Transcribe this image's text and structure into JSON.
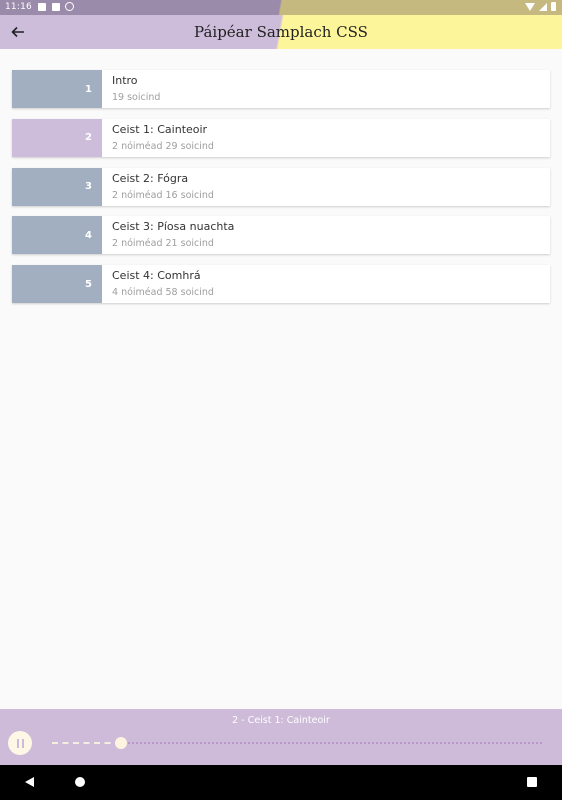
{
  "status_bar": {
    "time": "11:16"
  },
  "toolbar": {
    "title": "Páipéar Samplach CSS"
  },
  "colors": {
    "grey_block": "#a1afc0",
    "purple_block": "#cdbdda",
    "toolbar_left": "#cdbdda",
    "toolbar_right": "#fdf59a",
    "player_bg": "#cdbbd9"
  },
  "tracks": [
    {
      "number": "1",
      "title": "Intro",
      "duration": "19 soicind",
      "color": "#a1afc0"
    },
    {
      "number": "2",
      "title": "Ceist 1: Cainteoir",
      "duration": "2 nóiméad 29 soicind",
      "color": "#cdbdda"
    },
    {
      "number": "3",
      "title": "Ceist 2: Fógra",
      "duration": "2 nóiméad 16 soicind",
      "color": "#a1afc0"
    },
    {
      "number": "4",
      "title": "Ceist 3: Píosa nuachta",
      "duration": "2 nóiméad 21 soicind",
      "color": "#a1afc0"
    },
    {
      "number": "5",
      "title": "Ceist 4: Comhrá",
      "duration": "4 nóiméad 58 soicind",
      "color": "#a1afc0"
    }
  ],
  "player": {
    "now_playing": "2 - Ceist 1: Cainteoir",
    "progress": 0.14
  }
}
